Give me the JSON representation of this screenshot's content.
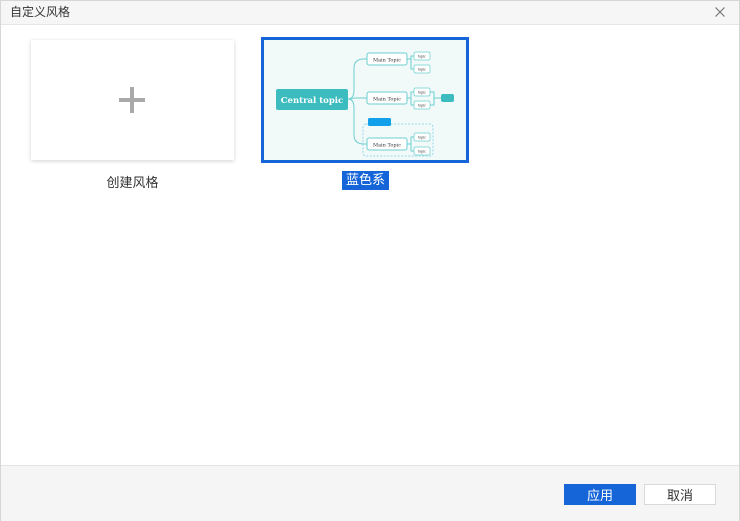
{
  "dialog": {
    "title": "自定义风格"
  },
  "styles": {
    "create_label": "创建风格",
    "selected_label": "蓝色系",
    "preview": {
      "central_topic": "Central topic",
      "main_topic": "Main Topic",
      "subtopic": "topic"
    }
  },
  "footer": {
    "apply_label": "应用",
    "cancel_label": "取消"
  },
  "colors": {
    "accent": "#1565d8",
    "teal": "#3cbcbf"
  },
  "icons": {
    "close": "close-icon",
    "add": "plus-icon"
  }
}
